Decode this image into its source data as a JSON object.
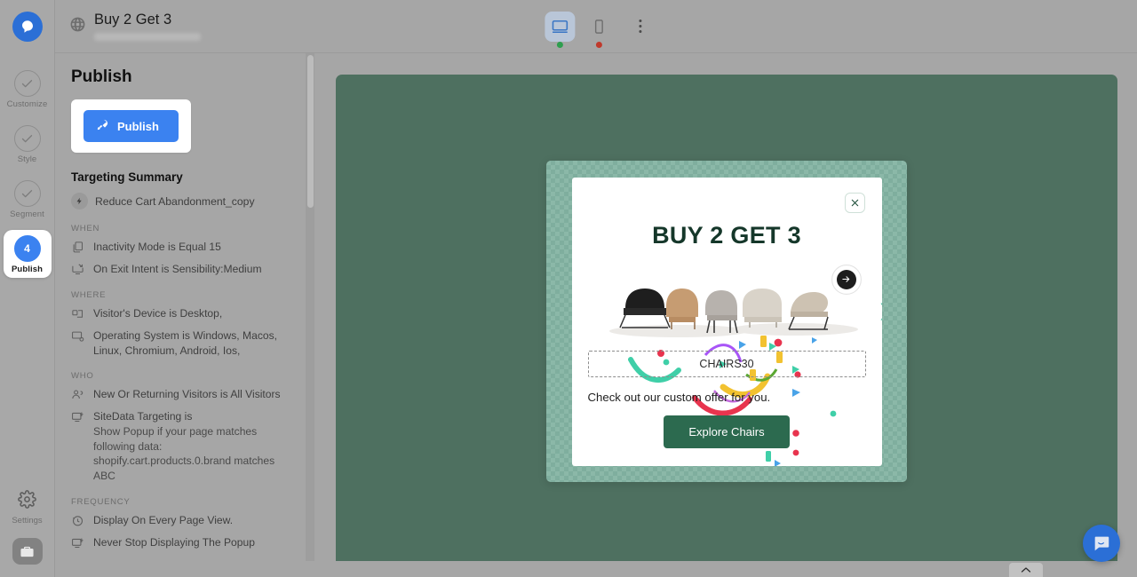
{
  "header": {
    "site_icon": "globe-icon",
    "site_title": "Buy 2 Get 3",
    "site_url_masked": "",
    "devices": [
      {
        "name": "desktop",
        "icon": "desktop-icon",
        "active": true,
        "status": "online",
        "status_color": "#2e9e4f"
      },
      {
        "name": "mobile",
        "icon": "mobile-icon",
        "active": false,
        "status": "offline",
        "status_color": "#c0392b"
      }
    ],
    "more_menu": "kebab-menu-icon"
  },
  "rail": {
    "logo": "app-logo",
    "steps": [
      {
        "label": "Customize",
        "state": "complete",
        "icon": "check-icon"
      },
      {
        "label": "Style",
        "state": "complete",
        "icon": "check-icon"
      },
      {
        "label": "Segment",
        "state": "complete",
        "icon": "check-icon"
      },
      {
        "label": "Publish",
        "state": "active",
        "number": "4"
      }
    ],
    "settings_label": "Settings",
    "settings_icon": "gear-icon",
    "briefcase_icon": "briefcase-icon"
  },
  "panel": {
    "title": "Publish",
    "publish_button": "Publish",
    "publish_icon": "rocket-icon",
    "targeting_title": "Targeting Summary",
    "campaign_name": "Reduce Cart Abandonment_copy",
    "sections": [
      {
        "heading": "WHEN",
        "items": [
          {
            "icon": "copy-icon",
            "text": "Inactivity Mode is Equal 15"
          },
          {
            "icon": "exit-intent-icon",
            "text": "On Exit Intent is Sensibility:Medium"
          }
        ]
      },
      {
        "heading": "WHERE",
        "items": [
          {
            "icon": "device-icon",
            "text": "Visitor's Device is Desktop,"
          },
          {
            "icon": "os-icon",
            "text": "Operating System is Windows, Macos, Linux, Chromium, Android, Ios,"
          }
        ]
      },
      {
        "heading": "WHO",
        "items": [
          {
            "icon": "users-icon",
            "text": "New Or Returning Visitors is All Visitors"
          },
          {
            "icon": "sitedata-icon",
            "text": "SiteData Targeting is",
            "subtext": "Show Popup if your page matches following data: shopify.cart.products.0.brand matches ABC"
          }
        ]
      },
      {
        "heading": "FREQUENCY",
        "items": [
          {
            "icon": "clock-icon",
            "text": "Display On Every Page View."
          },
          {
            "icon": "sitedata-icon",
            "text": "Never Stop Displaying The Popup"
          }
        ]
      }
    ]
  },
  "preview": {
    "stage_color": "#4e7060",
    "popup_frame_color": "#8bb8a8",
    "close_icon": "close-icon",
    "headline": "BUY 2 GET 3",
    "headline_color": "#15372a",
    "badge_arrow_icon": "arrow-right-icon",
    "coupon_code": "CHAIRS30",
    "subtext": "Check out our custom offer for you.",
    "cta_label": "Explore Chairs",
    "cta_color": "#2c6a4f",
    "chairs": [
      {
        "name": "chair-black",
        "color": "#1e1e1e"
      },
      {
        "name": "chair-tan",
        "color": "#c69c72"
      },
      {
        "name": "chair-grey",
        "color": "#b7b2ad"
      },
      {
        "name": "chair-cream",
        "color": "#d9d3c9"
      },
      {
        "name": "chair-beige",
        "color": "#cdc2b2"
      }
    ]
  },
  "chat": {
    "icon": "chat-bubble-icon",
    "color": "#2b6fd6"
  },
  "bottom": {
    "expand_icon": "chevron-up-icon"
  }
}
